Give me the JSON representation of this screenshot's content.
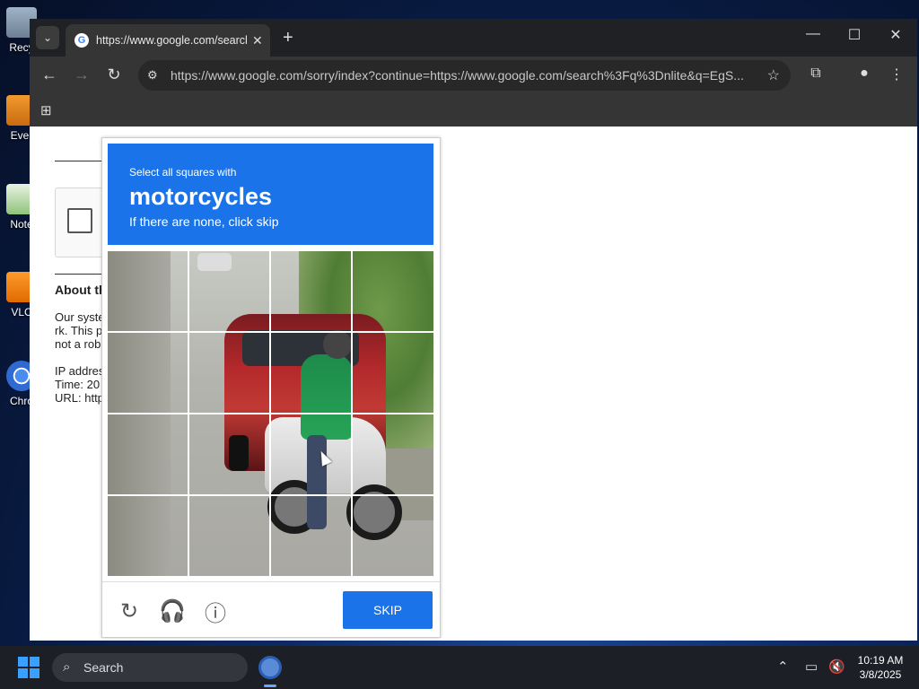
{
  "desktop": {
    "icons": [
      {
        "label": "Recy"
      },
      {
        "label": "Ever"
      },
      {
        "label": "Note"
      },
      {
        "label": "VLC"
      },
      {
        "label": "Chro"
      }
    ]
  },
  "browser": {
    "tab": {
      "title": "https://www.google.com/search"
    },
    "omnibox": {
      "url": "https://www.google.com/sorry/index?continue=https://www.google.com/search%3Fq%3Dnlite&q=EgS..."
    },
    "window_controls": {
      "minimize": "—",
      "maximize": "☐",
      "close": "✕"
    }
  },
  "background_page": {
    "heading": "About th",
    "line1": "Our syste",
    "line2": "rk. This p",
    "line3": "not a rob",
    "ip": "IP addres",
    "time": "Time: 20",
    "url": "URL: http"
  },
  "captcha": {
    "intro": "Select all squares with",
    "object": "motorcycles",
    "hint": "If there are none, click skip",
    "skip_label": "SKIP",
    "accent": "#1a73e8"
  },
  "taskbar": {
    "search_label": "Search",
    "time": "10:19 AM",
    "date": "3/8/2025"
  }
}
